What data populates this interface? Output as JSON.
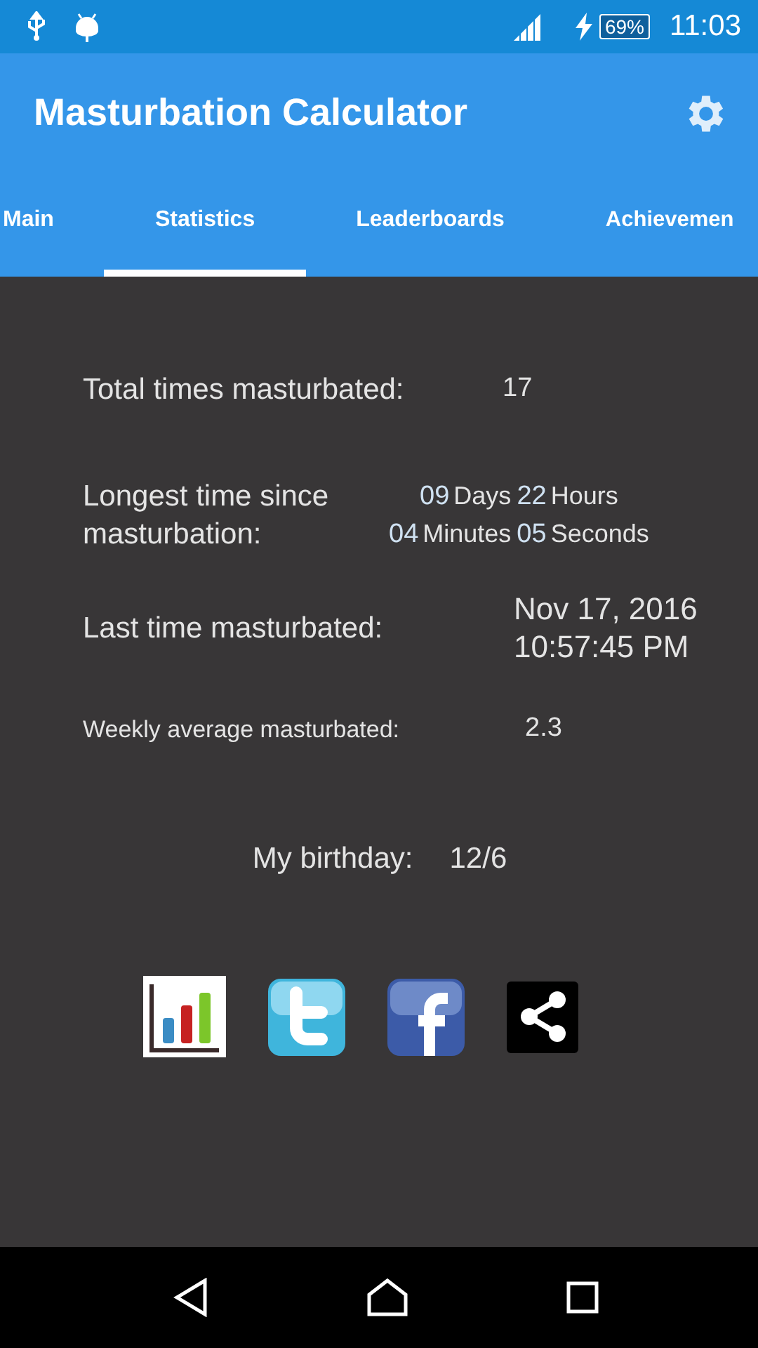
{
  "status_bar": {
    "battery": "69%",
    "time": "11:03"
  },
  "app_bar": {
    "title": "Masturbation Calculator"
  },
  "tabs": [
    {
      "label": "Main",
      "selected": false
    },
    {
      "label": "Statistics",
      "selected": true
    },
    {
      "label": "Leaderboards",
      "selected": false
    },
    {
      "label": "Achievemen",
      "selected": false
    }
  ],
  "stats": [
    {
      "kind": "simple",
      "label": "Total times masturbated:",
      "value": "17"
    },
    {
      "kind": "duration",
      "label": "Longest time since masturbation:",
      "lines": [
        [
          {
            "number": "09",
            "unit": "Days"
          },
          {
            "number": "22",
            "unit": "Hours"
          }
        ],
        [
          {
            "number": "04",
            "unit": "Minutes"
          },
          {
            "number": "05",
            "unit": "Seconds"
          }
        ]
      ]
    },
    {
      "kind": "datetime",
      "label": "Last time masturbated:",
      "lines": [
        "Nov 17, 2016",
        "10:57:45 PM"
      ]
    },
    {
      "kind": "small",
      "label": "Weekly average masturbated:",
      "value": "2.3"
    }
  ],
  "birthday": {
    "label": "My birthday:",
    "value": "12/6"
  }
}
